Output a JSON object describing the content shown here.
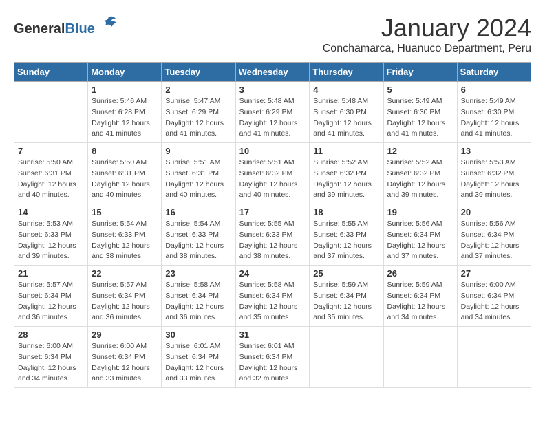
{
  "logo": {
    "general": "General",
    "blue": "Blue"
  },
  "header": {
    "title": "January 2024",
    "subtitle": "Conchamarca, Huanuco Department, Peru"
  },
  "weekdays": [
    "Sunday",
    "Monday",
    "Tuesday",
    "Wednesday",
    "Thursday",
    "Friday",
    "Saturday"
  ],
  "weeks": [
    [
      {
        "day": "",
        "content": ""
      },
      {
        "day": "1",
        "content": "Sunrise: 5:46 AM\nSunset: 6:28 PM\nDaylight: 12 hours\nand 41 minutes."
      },
      {
        "day": "2",
        "content": "Sunrise: 5:47 AM\nSunset: 6:29 PM\nDaylight: 12 hours\nand 41 minutes."
      },
      {
        "day": "3",
        "content": "Sunrise: 5:48 AM\nSunset: 6:29 PM\nDaylight: 12 hours\nand 41 minutes."
      },
      {
        "day": "4",
        "content": "Sunrise: 5:48 AM\nSunset: 6:30 PM\nDaylight: 12 hours\nand 41 minutes."
      },
      {
        "day": "5",
        "content": "Sunrise: 5:49 AM\nSunset: 6:30 PM\nDaylight: 12 hours\nand 41 minutes."
      },
      {
        "day": "6",
        "content": "Sunrise: 5:49 AM\nSunset: 6:30 PM\nDaylight: 12 hours\nand 41 minutes."
      }
    ],
    [
      {
        "day": "7",
        "content": "Sunrise: 5:50 AM\nSunset: 6:31 PM\nDaylight: 12 hours\nand 40 minutes."
      },
      {
        "day": "8",
        "content": "Sunrise: 5:50 AM\nSunset: 6:31 PM\nDaylight: 12 hours\nand 40 minutes."
      },
      {
        "day": "9",
        "content": "Sunrise: 5:51 AM\nSunset: 6:31 PM\nDaylight: 12 hours\nand 40 minutes."
      },
      {
        "day": "10",
        "content": "Sunrise: 5:51 AM\nSunset: 6:32 PM\nDaylight: 12 hours\nand 40 minutes."
      },
      {
        "day": "11",
        "content": "Sunrise: 5:52 AM\nSunset: 6:32 PM\nDaylight: 12 hours\nand 39 minutes."
      },
      {
        "day": "12",
        "content": "Sunrise: 5:52 AM\nSunset: 6:32 PM\nDaylight: 12 hours\nand 39 minutes."
      },
      {
        "day": "13",
        "content": "Sunrise: 5:53 AM\nSunset: 6:32 PM\nDaylight: 12 hours\nand 39 minutes."
      }
    ],
    [
      {
        "day": "14",
        "content": "Sunrise: 5:53 AM\nSunset: 6:33 PM\nDaylight: 12 hours\nand 39 minutes."
      },
      {
        "day": "15",
        "content": "Sunrise: 5:54 AM\nSunset: 6:33 PM\nDaylight: 12 hours\nand 38 minutes."
      },
      {
        "day": "16",
        "content": "Sunrise: 5:54 AM\nSunset: 6:33 PM\nDaylight: 12 hours\nand 38 minutes."
      },
      {
        "day": "17",
        "content": "Sunrise: 5:55 AM\nSunset: 6:33 PM\nDaylight: 12 hours\nand 38 minutes."
      },
      {
        "day": "18",
        "content": "Sunrise: 5:55 AM\nSunset: 6:33 PM\nDaylight: 12 hours\nand 37 minutes."
      },
      {
        "day": "19",
        "content": "Sunrise: 5:56 AM\nSunset: 6:34 PM\nDaylight: 12 hours\nand 37 minutes."
      },
      {
        "day": "20",
        "content": "Sunrise: 5:56 AM\nSunset: 6:34 PM\nDaylight: 12 hours\nand 37 minutes."
      }
    ],
    [
      {
        "day": "21",
        "content": "Sunrise: 5:57 AM\nSunset: 6:34 PM\nDaylight: 12 hours\nand 36 minutes."
      },
      {
        "day": "22",
        "content": "Sunrise: 5:57 AM\nSunset: 6:34 PM\nDaylight: 12 hours\nand 36 minutes."
      },
      {
        "day": "23",
        "content": "Sunrise: 5:58 AM\nSunset: 6:34 PM\nDaylight: 12 hours\nand 36 minutes."
      },
      {
        "day": "24",
        "content": "Sunrise: 5:58 AM\nSunset: 6:34 PM\nDaylight: 12 hours\nand 35 minutes."
      },
      {
        "day": "25",
        "content": "Sunrise: 5:59 AM\nSunset: 6:34 PM\nDaylight: 12 hours\nand 35 minutes."
      },
      {
        "day": "26",
        "content": "Sunrise: 5:59 AM\nSunset: 6:34 PM\nDaylight: 12 hours\nand 34 minutes."
      },
      {
        "day": "27",
        "content": "Sunrise: 6:00 AM\nSunset: 6:34 PM\nDaylight: 12 hours\nand 34 minutes."
      }
    ],
    [
      {
        "day": "28",
        "content": "Sunrise: 6:00 AM\nSunset: 6:34 PM\nDaylight: 12 hours\nand 34 minutes."
      },
      {
        "day": "29",
        "content": "Sunrise: 6:00 AM\nSunset: 6:34 PM\nDaylight: 12 hours\nand 33 minutes."
      },
      {
        "day": "30",
        "content": "Sunrise: 6:01 AM\nSunset: 6:34 PM\nDaylight: 12 hours\nand 33 minutes."
      },
      {
        "day": "31",
        "content": "Sunrise: 6:01 AM\nSunset: 6:34 PM\nDaylight: 12 hours\nand 32 minutes."
      },
      {
        "day": "",
        "content": ""
      },
      {
        "day": "",
        "content": ""
      },
      {
        "day": "",
        "content": ""
      }
    ]
  ]
}
